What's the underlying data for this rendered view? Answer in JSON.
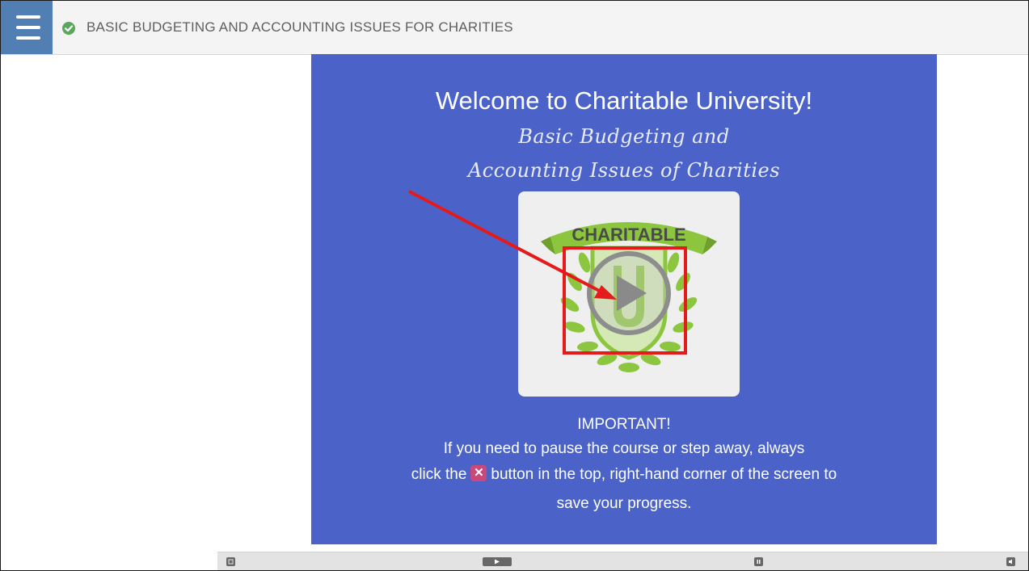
{
  "header": {
    "menu_icon": "hamburger-menu-icon",
    "status_icon": "check-circle-icon",
    "course_title": "BASIC BUDGETING AND ACCOUNTING ISSUES FOR CHARITIES"
  },
  "slide": {
    "welcome": "Welcome to Charitable University!",
    "subtitle_line1": "Basic Budgeting and",
    "subtitle_line2": "Accounting Issues of Charities",
    "logo_text": "CHARITABLE",
    "logo_letter": "U",
    "play_icon": "play-icon",
    "important_heading": "IMPORTANT!",
    "important_line1": "If you need to pause the course or step away, always",
    "important_line2_before": "click the",
    "close_icon": "close-x-icon",
    "important_line2_after": "button in the top, right-hand corner of the screen to",
    "important_line3": "save your progress."
  },
  "colors": {
    "slide_bg": "#4b63c9",
    "menu_bg": "#527fb3",
    "highlight": "#e51a1a",
    "logo_green": "#8cc63e",
    "close_button": "#c9497b"
  },
  "controls": {
    "icons": [
      "exit-icon",
      "play-icon",
      "pause-icon",
      "volume-icon"
    ]
  }
}
